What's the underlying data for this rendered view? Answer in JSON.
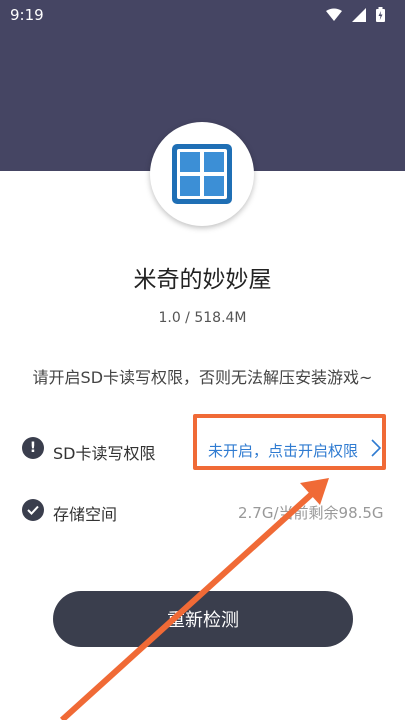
{
  "status_bar": {
    "time": "9:19",
    "icons": [
      "wifi-icon",
      "signal-icon",
      "battery-icon"
    ]
  },
  "app": {
    "name": "米奇的妙妙屋",
    "version_size": "1.0 / 518.4M",
    "icon": "window-grid-icon"
  },
  "notice": "请开启SD卡读写权限，否则无法解压安装游戏~",
  "rows": {
    "sd_permission": {
      "label": "SD卡读写权限",
      "action": "未开启，点击开启权限",
      "icon": "exclamation-circle-icon"
    },
    "storage": {
      "label": "存储空间",
      "value": "2.7G/当前剩余98.5G",
      "icon": "check-circle-icon"
    }
  },
  "recheck_button": "重新检测",
  "colors": {
    "header": "#454563",
    "button": "#3a3e4d",
    "link": "#2f7bd1",
    "highlight": "#f06a36"
  }
}
